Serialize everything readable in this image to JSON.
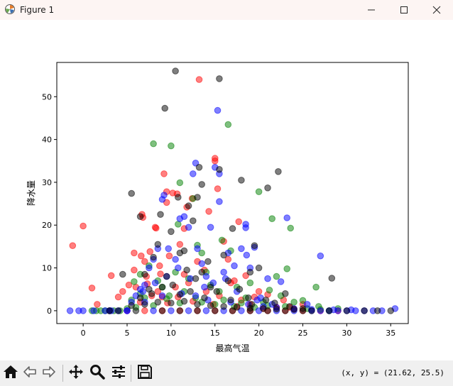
{
  "window": {
    "title": "Figure 1",
    "icon": "matplotlib-figure-icon",
    "controls": [
      "minimize-icon",
      "maximize-icon",
      "close-icon"
    ]
  },
  "toolbar": {
    "buttons": [
      "home-icon",
      "back-icon",
      "forward-icon",
      "pan-icon",
      "zoom-icon",
      "configure-subplots-icon",
      "save-icon"
    ],
    "coordinate_readout": "(x, y) = (21.62, 25.5)"
  },
  "chart_data": {
    "type": "scatter",
    "xlabel": "最高气温",
    "ylabel": "降水量",
    "xlim": [
      -3,
      37
    ],
    "ylim": [
      -3,
      58
    ],
    "xticks": [
      0,
      5,
      10,
      15,
      20,
      25,
      30,
      35
    ],
    "yticks": [
      0,
      10,
      20,
      30,
      40,
      50
    ],
    "grid": false,
    "marker_alpha": 0.5,
    "series": [
      {
        "color": "#ff0000",
        "points": [
          [
            -1.2,
            15.2
          ],
          [
            0,
            19.8
          ],
          [
            1,
            5.3
          ],
          [
            1.6,
            1.5
          ],
          [
            3.2,
            8.2
          ],
          [
            4,
            3.2
          ],
          [
            4.5,
            4.5
          ],
          [
            5.2,
            6
          ],
          [
            5.8,
            9.5
          ],
          [
            5.8,
            13.5
          ],
          [
            6.7,
            22.5
          ],
          [
            6.8,
            21.8
          ],
          [
            6.6,
            12.8
          ],
          [
            7,
            11.5
          ],
          [
            7.2,
            8
          ],
          [
            7.6,
            13.8
          ],
          [
            8.2,
            19.5
          ],
          [
            8.3,
            19.3
          ],
          [
            8.7,
            10.5
          ],
          [
            8.8,
            8.6
          ],
          [
            9.2,
            32
          ],
          [
            9.5,
            27.8
          ],
          [
            9.5,
            25.3
          ],
          [
            9.8,
            12.8
          ],
          [
            10.2,
            27.5
          ],
          [
            10.7,
            27.3
          ],
          [
            11,
            15.5
          ],
          [
            11.5,
            19.2
          ],
          [
            11.8,
            24.2
          ],
          [
            12.4,
            26.2
          ],
          [
            13.2,
            54
          ],
          [
            13.8,
            9.5
          ],
          [
            14.3,
            23.2
          ],
          [
            15,
            35.6
          ],
          [
            15,
            35
          ],
          [
            15.3,
            28.5
          ],
          [
            16,
            16.2
          ],
          [
            16.5,
            12
          ],
          [
            17.2,
            7
          ],
          [
            17.7,
            20.8
          ],
          [
            18.5,
            8.2
          ],
          [
            19.5,
            3.2
          ],
          [
            21,
            3.8
          ],
          [
            22.8,
            2.5
          ],
          [
            23.5,
            0.8
          ],
          [
            25,
            1.5
          ],
          [
            6,
            5.5
          ],
          [
            7.3,
            6.3
          ],
          [
            8.5,
            4.5
          ],
          [
            9,
            3.2
          ],
          [
            10.5,
            5.5
          ],
          [
            11.5,
            8.5
          ],
          [
            12,
            6.5
          ],
          [
            13,
            11.5
          ],
          [
            14,
            4.5
          ],
          [
            15.5,
            3.5
          ],
          [
            16.8,
            6.5
          ],
          [
            18,
            2.5
          ],
          [
            19,
            1.5
          ],
          [
            20,
            4.5
          ],
          [
            6.5,
            2
          ],
          [
            7.8,
            3.5
          ],
          [
            9.6,
            1.8
          ],
          [
            10.8,
            3.2
          ],
          [
            12.5,
            2.2
          ],
          [
            14.8,
            1.5
          ],
          [
            17.5,
            1
          ],
          [
            20.5,
            0.5
          ],
          [
            22,
            0.8
          ],
          [
            24,
            0.4
          ],
          [
            3,
            0
          ],
          [
            5,
            0
          ],
          [
            7,
            0
          ],
          [
            9,
            0
          ],
          [
            11,
            0
          ],
          [
            13,
            0
          ],
          [
            15,
            0
          ],
          [
            17,
            0
          ],
          [
            19,
            0
          ],
          [
            21,
            0
          ],
          [
            23,
            0
          ],
          [
            25,
            0
          ],
          [
            27,
            0
          ],
          [
            29,
            0
          ]
        ]
      },
      {
        "color": "#008000",
        "points": [
          [
            1,
            0
          ],
          [
            1.5,
            0
          ],
          [
            2,
            0
          ],
          [
            2.5,
            0
          ],
          [
            3,
            0
          ],
          [
            3.5,
            0
          ],
          [
            4.2,
            0
          ],
          [
            5.5,
            2.5
          ],
          [
            5.8,
            6.8
          ],
          [
            6.5,
            8.5
          ],
          [
            7.5,
            10.5
          ],
          [
            8,
            39
          ],
          [
            9.5,
            2.8
          ],
          [
            10,
            38.5
          ],
          [
            10.8,
            20.2
          ],
          [
            11,
            29.9
          ],
          [
            12.5,
            26.2
          ],
          [
            13,
            15.3
          ],
          [
            13.5,
            13.5
          ],
          [
            14,
            9
          ],
          [
            15.8,
            16.5
          ],
          [
            16.5,
            43.5
          ],
          [
            16.8,
            14
          ],
          [
            17.5,
            5.5
          ],
          [
            18.5,
            3
          ],
          [
            20,
            27.8
          ],
          [
            21.5,
            21.5
          ],
          [
            21.2,
            4.8
          ],
          [
            22,
            8
          ],
          [
            23.2,
            9.8
          ],
          [
            23.6,
            19.3
          ],
          [
            25,
            2.4
          ],
          [
            26.5,
            5.5
          ],
          [
            26.8,
            1
          ],
          [
            28,
            0
          ],
          [
            29,
            0.5
          ],
          [
            8.5,
            7
          ],
          [
            9,
            5.5
          ],
          [
            10.5,
            9
          ],
          [
            11.5,
            4.5
          ],
          [
            12,
            7.5
          ],
          [
            14.5,
            6
          ],
          [
            15.5,
            4.5
          ],
          [
            19,
            6.5
          ],
          [
            20.5,
            2
          ],
          [
            22.5,
            3.5
          ],
          [
            6.5,
            4
          ],
          [
            7,
            3
          ],
          [
            9.8,
            3.5
          ],
          [
            12.8,
            3
          ],
          [
            16,
            2.5
          ],
          [
            18,
            1.8
          ],
          [
            24,
            2
          ],
          [
            5,
            0.5
          ],
          [
            6,
            0.8
          ],
          [
            8,
            1.2
          ],
          [
            11,
            1.8
          ],
          [
            13.5,
            2
          ],
          [
            15,
            1.5
          ],
          [
            17.2,
            1
          ],
          [
            19.5,
            0.8
          ],
          [
            21,
            1.2
          ],
          [
            23,
            1
          ],
          [
            25.5,
            0.5
          ],
          [
            27,
            0.3
          ]
        ]
      },
      {
        "color": "#0000ff",
        "points": [
          [
            -1.5,
            0
          ],
          [
            -0.5,
            0
          ],
          [
            0,
            0
          ],
          [
            1.2,
            0
          ],
          [
            2.5,
            0
          ],
          [
            3,
            0
          ],
          [
            3.2,
            0
          ],
          [
            4,
            0
          ],
          [
            5,
            0
          ],
          [
            5.5,
            2
          ],
          [
            6,
            3.5
          ],
          [
            6.5,
            5
          ],
          [
            7,
            6
          ],
          [
            7.5,
            10
          ],
          [
            8,
            12
          ],
          [
            8.5,
            14.5
          ],
          [
            9,
            26
          ],
          [
            9.2,
            27
          ],
          [
            9.7,
            14.5
          ],
          [
            10.5,
            12
          ],
          [
            11,
            21.5
          ],
          [
            11.5,
            22
          ],
          [
            12,
            19.5
          ],
          [
            12.5,
            32
          ],
          [
            12.8,
            34.5
          ],
          [
            13,
            14.5
          ],
          [
            13.5,
            11
          ],
          [
            14,
            8
          ],
          [
            14.5,
            19.5
          ],
          [
            15,
            33.5
          ],
          [
            15.3,
            46.8
          ],
          [
            15.5,
            25.5
          ],
          [
            15.5,
            32
          ],
          [
            16,
            9
          ],
          [
            16.5,
            13.5
          ],
          [
            17.2,
            10.5
          ],
          [
            18,
            14.5
          ],
          [
            18.5,
            20.2
          ],
          [
            18.5,
            19.4
          ],
          [
            18.6,
            13
          ],
          [
            19,
            10
          ],
          [
            19.5,
            14.8
          ],
          [
            20.2,
            3
          ],
          [
            21,
            7.5
          ],
          [
            22.5,
            6.8
          ],
          [
            23.2,
            21.7
          ],
          [
            25.5,
            1.5
          ],
          [
            27,
            12.8
          ],
          [
            28,
            0
          ],
          [
            29,
            0
          ],
          [
            30,
            0
          ],
          [
            31,
            0
          ],
          [
            32,
            0
          ],
          [
            33,
            0
          ],
          [
            34,
            0
          ],
          [
            35.5,
            0.5
          ],
          [
            6.8,
            4.5
          ],
          [
            8.2,
            6.5
          ],
          [
            9.5,
            8
          ],
          [
            10.8,
            10
          ],
          [
            12.2,
            7.5
          ],
          [
            13.8,
            5.5
          ],
          [
            14.8,
            6.5
          ],
          [
            16.2,
            7.5
          ],
          [
            17.5,
            4.5
          ],
          [
            19.8,
            2.5
          ],
          [
            21.5,
            1.5
          ],
          [
            7,
            2
          ],
          [
            9,
            3.5
          ],
          [
            11.2,
            4
          ],
          [
            12.8,
            3.5
          ],
          [
            14.2,
            2.5
          ],
          [
            16.8,
            2
          ],
          [
            18.8,
            1.5
          ],
          [
            20.5,
            1
          ],
          [
            22,
            0.8
          ],
          [
            24,
            0.5
          ],
          [
            26,
            0.3
          ],
          [
            28.5,
            0.2
          ],
          [
            30.5,
            0.2
          ],
          [
            5,
            0
          ],
          [
            8,
            0
          ],
          [
            10,
            0
          ],
          [
            12,
            0
          ],
          [
            14,
            0
          ],
          [
            16,
            0
          ],
          [
            18,
            0
          ],
          [
            20,
            0
          ],
          [
            22,
            0
          ],
          [
            24,
            0
          ],
          [
            26,
            0
          ],
          [
            27,
            0
          ]
        ]
      },
      {
        "color": "#000000",
        "points": [
          [
            4.5,
            8.5
          ],
          [
            5.5,
            27.4
          ],
          [
            6.5,
            22
          ],
          [
            7,
            8.5
          ],
          [
            7.5,
            5
          ],
          [
            8,
            12.5
          ],
          [
            8.5,
            15.5
          ],
          [
            8.8,
            22.5
          ],
          [
            9.3,
            47.3
          ],
          [
            10,
            18.5
          ],
          [
            10.5,
            56
          ],
          [
            10.8,
            26.5
          ],
          [
            11,
            13.5
          ],
          [
            11.5,
            14
          ],
          [
            12,
            24.5
          ],
          [
            12.5,
            21
          ],
          [
            13,
            26.5
          ],
          [
            13.2,
            33.5
          ],
          [
            13.5,
            29.5
          ],
          [
            13.5,
            9
          ],
          [
            14.2,
            11.5
          ],
          [
            15.5,
            54.2
          ],
          [
            15.5,
            33
          ],
          [
            16,
            13
          ],
          [
            17,
            19.2
          ],
          [
            18,
            30.5
          ],
          [
            19,
            9
          ],
          [
            19.5,
            15.2
          ],
          [
            20,
            10
          ],
          [
            21,
            28.7
          ],
          [
            22.2,
            32.5
          ],
          [
            23,
            4
          ],
          [
            25,
            0.5
          ],
          [
            28.3,
            7.6
          ],
          [
            9.5,
            8
          ],
          [
            10.2,
            6
          ],
          [
            11.8,
            9.5
          ],
          [
            12.8,
            7.5
          ],
          [
            14.5,
            5.5
          ],
          [
            16.5,
            7
          ],
          [
            17.8,
            5
          ],
          [
            18.8,
            3
          ],
          [
            20.8,
            2.5
          ],
          [
            6.5,
            3
          ],
          [
            7.8,
            4
          ],
          [
            9,
            5.5
          ],
          [
            11,
            3.8
          ],
          [
            12.2,
            4.5
          ],
          [
            13.8,
            3
          ],
          [
            15.2,
            4.5
          ],
          [
            16.8,
            2.5
          ],
          [
            19.2,
            1.5
          ],
          [
            21.8,
            1.8
          ],
          [
            23.5,
            1
          ],
          [
            5.5,
            1.2
          ],
          [
            7,
            1.5
          ],
          [
            8.5,
            2
          ],
          [
            10,
            1.8
          ],
          [
            11.5,
            2.2
          ],
          [
            13,
            1.5
          ],
          [
            14.5,
            1.2
          ],
          [
            16,
            1
          ],
          [
            17.5,
            0.8
          ],
          [
            19,
            0.6
          ],
          [
            20.5,
            0.5
          ],
          [
            22,
            0.4
          ],
          [
            24,
            0.3
          ],
          [
            3,
            0
          ],
          [
            4,
            0
          ],
          [
            6,
            0
          ],
          [
            9,
            0
          ],
          [
            11,
            0
          ],
          [
            13,
            0
          ],
          [
            15,
            0
          ],
          [
            17,
            0
          ],
          [
            19,
            0
          ],
          [
            21,
            0
          ],
          [
            23,
            0
          ],
          [
            25,
            0
          ],
          [
            26,
            0
          ],
          [
            28,
            0
          ],
          [
            30,
            0
          ],
          [
            32,
            0
          ],
          [
            33.5,
            0
          ],
          [
            35,
            0
          ]
        ]
      }
    ]
  }
}
